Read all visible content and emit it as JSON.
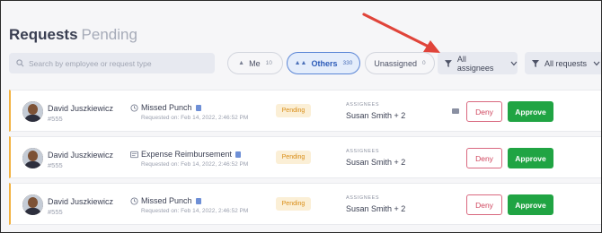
{
  "header": {
    "title": "Requests",
    "subtitle": "Pending"
  },
  "search": {
    "placeholder": "Search by employee or request type"
  },
  "segments": [
    {
      "label": "Me",
      "count": "10",
      "icon": "person-icon"
    },
    {
      "label": "Others",
      "count": "330",
      "icon": "people-icon",
      "selected": true
    },
    {
      "label": "Unassigned",
      "count": "0"
    }
  ],
  "filters": {
    "assignees": "All assignees",
    "requests": "All requests"
  },
  "requests": [
    {
      "name": "David Juszkiewicz",
      "employee_id": "#555",
      "type": "Missed Punch",
      "type_icon": "clock-icon",
      "requested_on": "Requested on: Feb 14, 2022, 2:46:52 PM",
      "status": "Pending",
      "assignees_label": "ASSIGNEES",
      "assignees": "Susan Smith + 2",
      "deny_label": "Deny",
      "approve_label": "Approve"
    },
    {
      "name": "David Juszkiewicz",
      "employee_id": "#555",
      "type": "Expense Reimbursement",
      "type_icon": "receipt-icon",
      "requested_on": "Requested on: Feb 14, 2022, 2:46:52 PM",
      "status": "Pending",
      "assignees_label": "ASSIGNEES",
      "assignees": "Susan Smith + 2",
      "deny_label": "Deny",
      "approve_label": "Approve"
    },
    {
      "name": "David Juszkiewicz",
      "employee_id": "#555",
      "type": "Missed Punch",
      "type_icon": "clock-icon",
      "requested_on": "Requested on: Feb 14, 2022, 2:46:52 PM",
      "status": "Pending",
      "assignees_label": "ASSIGNEES",
      "assignees": "Susan Smith + 2",
      "deny_label": "Deny",
      "approve_label": "Approve"
    }
  ],
  "colors": {
    "accent_blue": "#5b86d6",
    "pending": "#d98d16",
    "approve": "#20a443",
    "deny": "#d0475f",
    "annotation_arrow": "#e0443a"
  }
}
